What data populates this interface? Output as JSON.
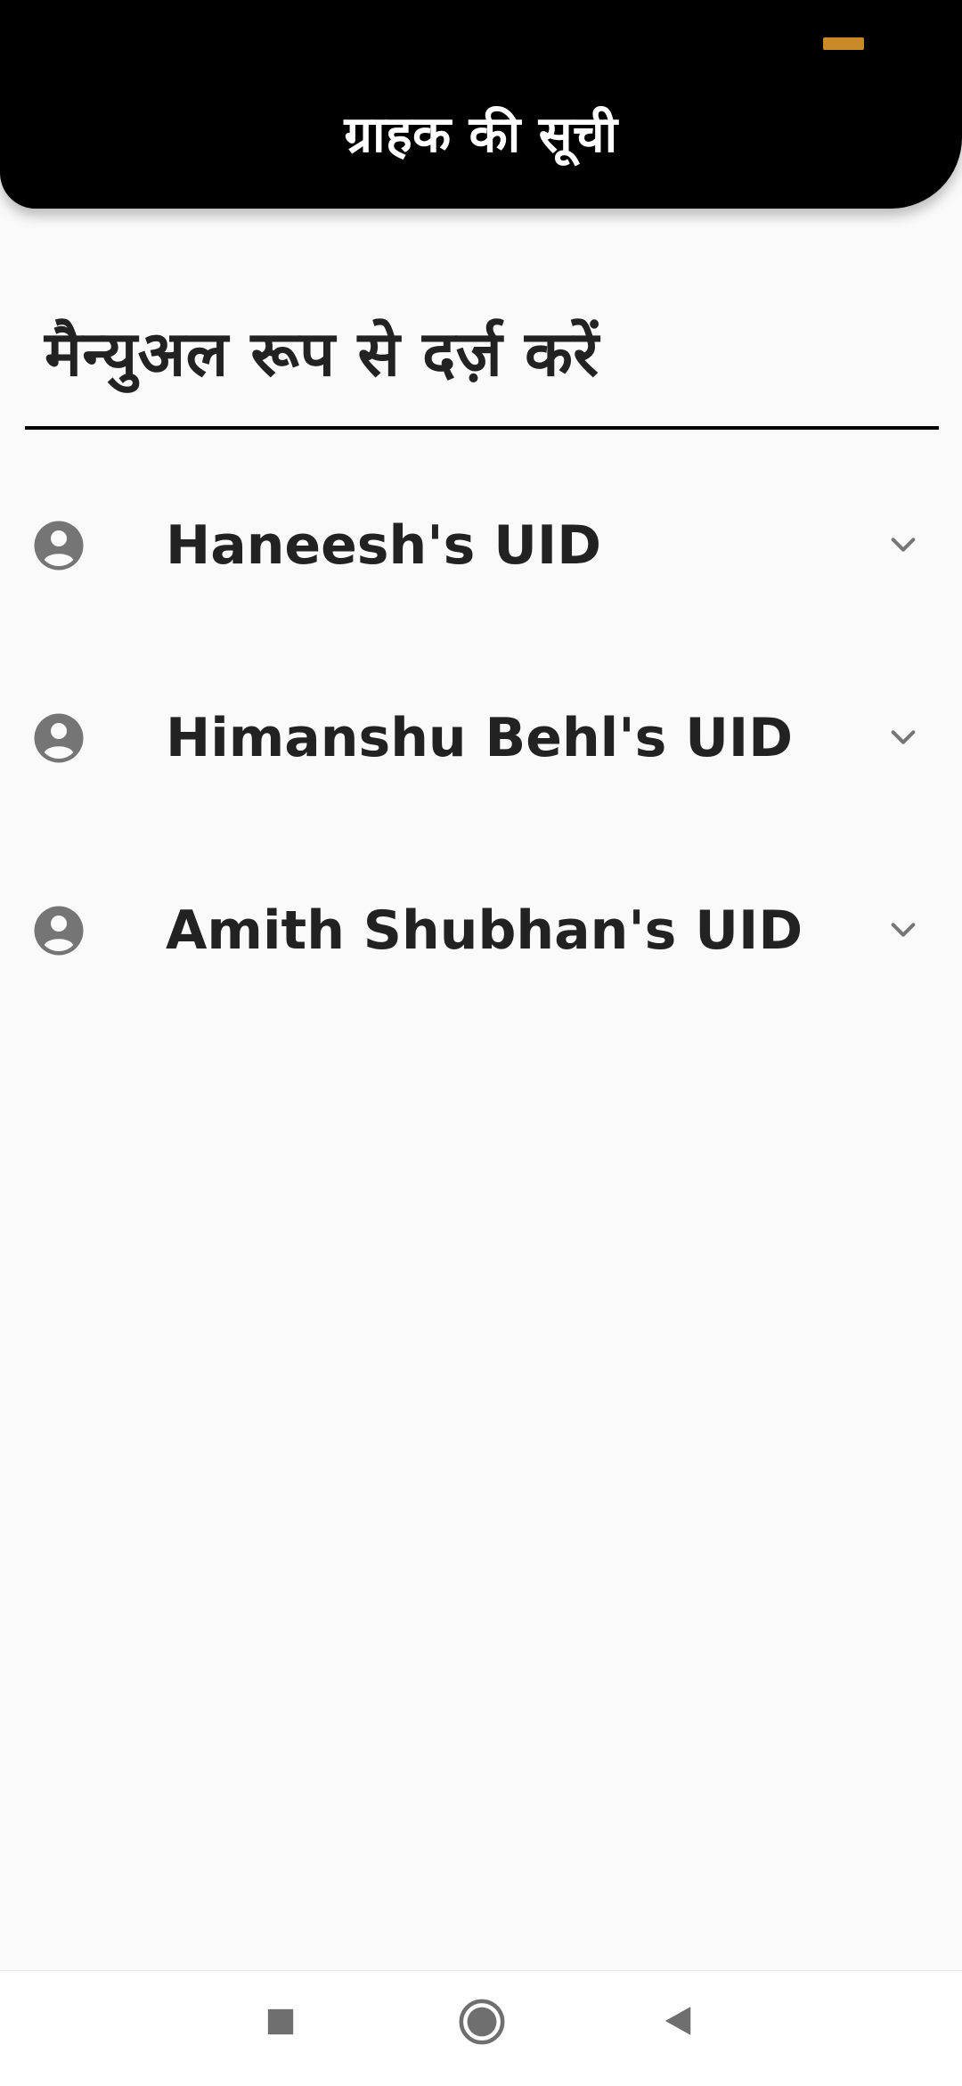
{
  "header": {
    "title": "ग्राहक की सूची",
    "status_indicator_color": "#c88a28"
  },
  "section": {
    "title": "मैन्युअल रूप से दर्ज़ करें"
  },
  "customers": [
    {
      "label": "Haneesh's UID",
      "icon": "account-circle-icon"
    },
    {
      "label": "Himanshu Behl's UID",
      "icon": "account-circle-icon"
    },
    {
      "label": "Amith Shubhan's UID",
      "icon": "account-circle-icon"
    }
  ],
  "navigation": {
    "recents": "square-icon",
    "home": "home-circle-icon",
    "back": "back-triangle-icon"
  },
  "colors": {
    "header_background": "#000000",
    "page_background": "#fafafa",
    "text_primary": "#222222",
    "icon_gray": "#757575"
  }
}
